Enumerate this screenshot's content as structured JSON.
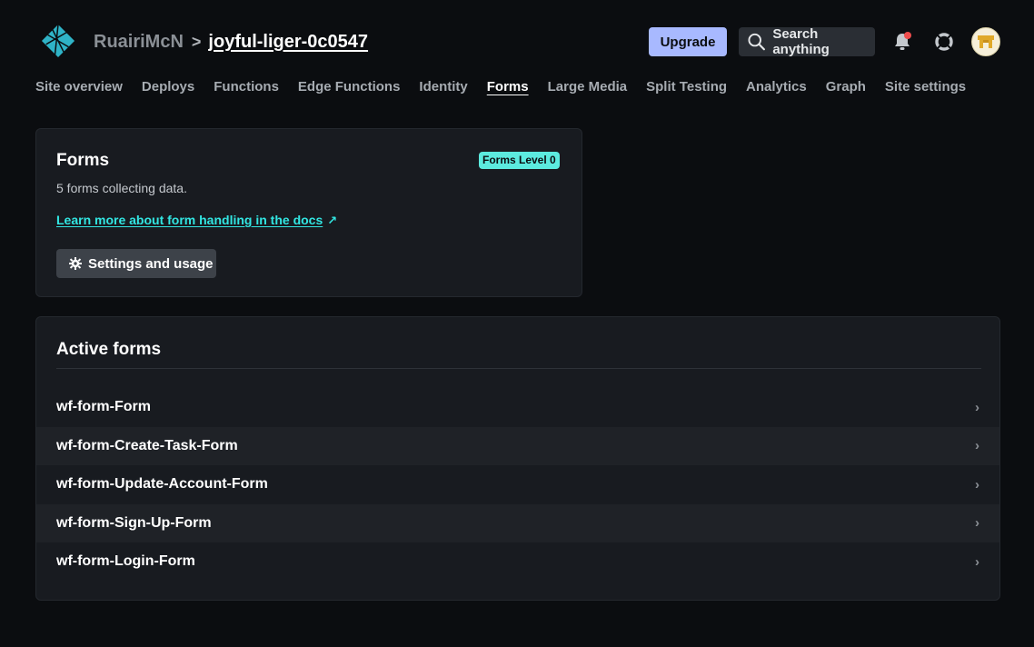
{
  "header": {
    "team": "RuairiMcN",
    "separator": ">",
    "site": "joyful-liger-0c0547",
    "upgrade_label": "Upgrade",
    "search_label": "Search anything"
  },
  "nav": {
    "items": [
      {
        "label": "Site overview",
        "active": false
      },
      {
        "label": "Deploys",
        "active": false
      },
      {
        "label": "Functions",
        "active": false
      },
      {
        "label": "Edge Functions",
        "active": false
      },
      {
        "label": "Identity",
        "active": false
      },
      {
        "label": "Forms",
        "active": true
      },
      {
        "label": "Large Media",
        "active": false
      },
      {
        "label": "Split Testing",
        "active": false
      },
      {
        "label": "Analytics",
        "active": false
      },
      {
        "label": "Graph",
        "active": false
      },
      {
        "label": "Site settings",
        "active": false
      }
    ]
  },
  "forms_card": {
    "title": "Forms",
    "badge": "Forms Level 0",
    "subtitle": "5 forms collecting data.",
    "docs_link": "Learn more about form handling in the docs",
    "docs_arrow": "↗",
    "settings_label": "Settings and usage"
  },
  "active_forms": {
    "title": "Active forms",
    "chevron": "›",
    "items": [
      {
        "name": "wf-form-Form"
      },
      {
        "name": "wf-form-Create-Task-Form"
      },
      {
        "name": "wf-form-Update-Account-Form"
      },
      {
        "name": "wf-form-Sign-Up-Form"
      },
      {
        "name": "wf-form-Login-Form"
      }
    ]
  },
  "colors": {
    "accent": "#32e6e2",
    "upgrade": "#a8b9ff",
    "badge": "#5cebdf",
    "notification": "#ef4d4d"
  },
  "icons": {
    "logo": "netlify-logo",
    "search": "search-icon",
    "bell": "bell-icon",
    "support": "lifebuoy-icon",
    "settings": "gear-icon",
    "chevron": "chevron-right-icon"
  }
}
